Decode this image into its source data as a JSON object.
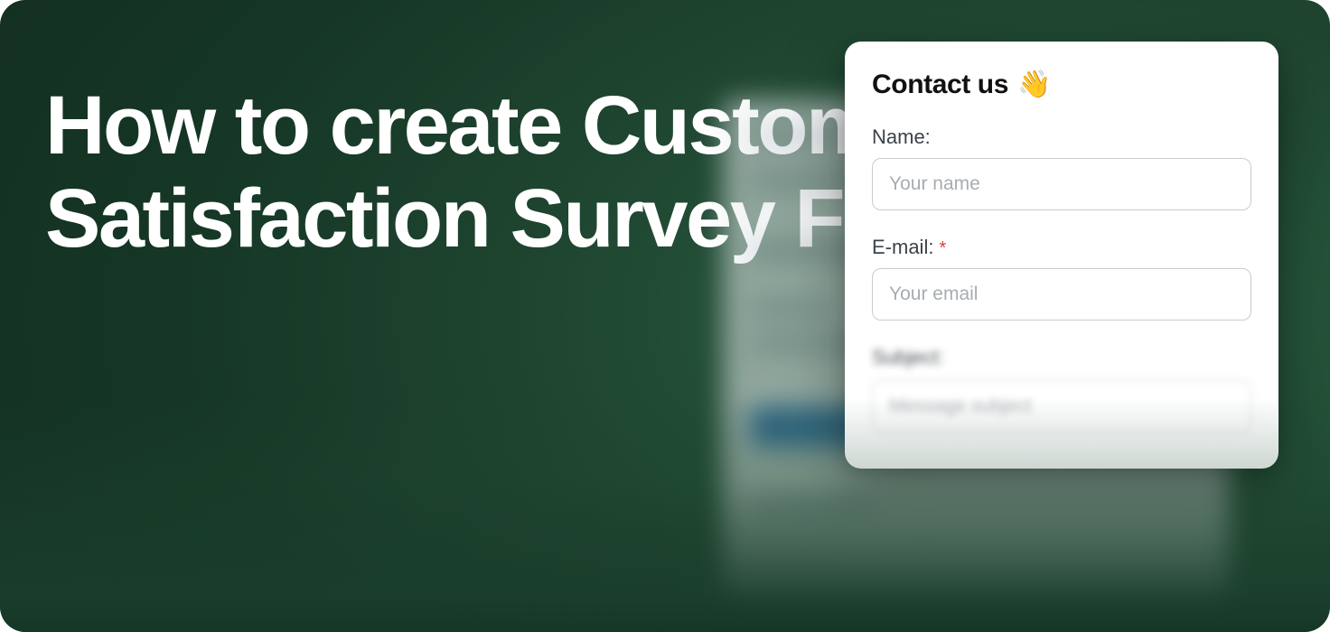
{
  "headline": "How to create Customer Satisfaction Survey Form",
  "card": {
    "title": "Contact us",
    "wave_emoji": "👋",
    "fields": {
      "name": {
        "label": "Name:",
        "placeholder": "Your name",
        "value": ""
      },
      "email": {
        "label": "E-mail:",
        "required_marker": "*",
        "placeholder": "Your email",
        "value": ""
      },
      "subject": {
        "label": "Subject:",
        "placeholder": "Message subject",
        "value": ""
      }
    }
  }
}
